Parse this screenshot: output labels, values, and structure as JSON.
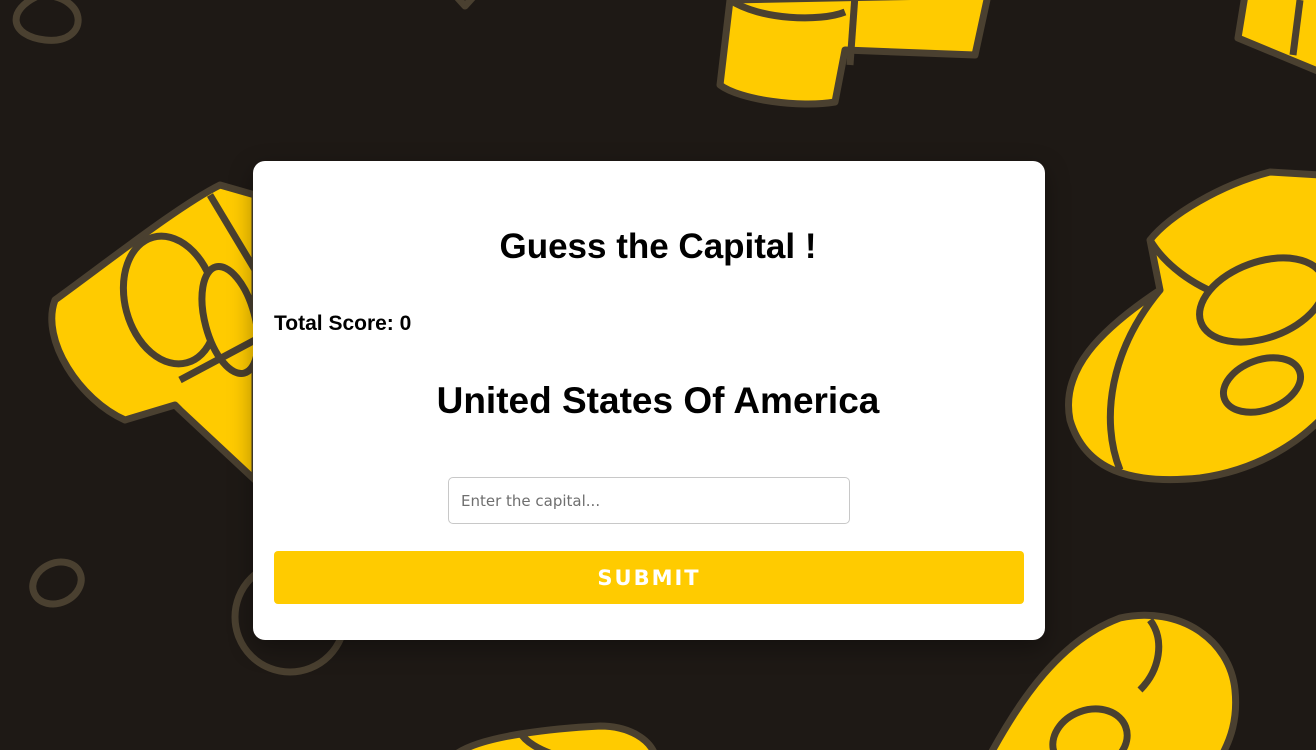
{
  "colors": {
    "background": "#1e1915",
    "accent": "#ffcb00",
    "outline": "#4a4030",
    "card": "#ffffff"
  },
  "decoration": {
    "icon": "tape-roll-pattern"
  },
  "game": {
    "title": "Guess the Capital !",
    "score_text": "Total Score: 0",
    "country": "United States Of America",
    "input": {
      "value": "",
      "placeholder": "Enter the capital..."
    },
    "submit_label": "SUBMIT"
  }
}
